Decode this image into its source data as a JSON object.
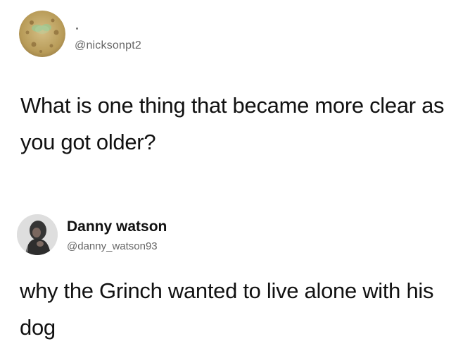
{
  "posts": [
    {
      "avatar_icon": "spongebob-texture-avatar-icon",
      "handle": "@nicksonpt2",
      "text": "What is one thing that became more clear as you got older?"
    },
    {
      "avatar_icon": "person-photo-avatar-icon",
      "name": "Danny watson",
      "handle": "@danny_watson93",
      "text": "why the Grinch wanted to live alone with his dog"
    }
  ],
  "colors": {
    "background": "#ffffff",
    "text_primary": "#111111",
    "text_secondary": "#666666"
  }
}
